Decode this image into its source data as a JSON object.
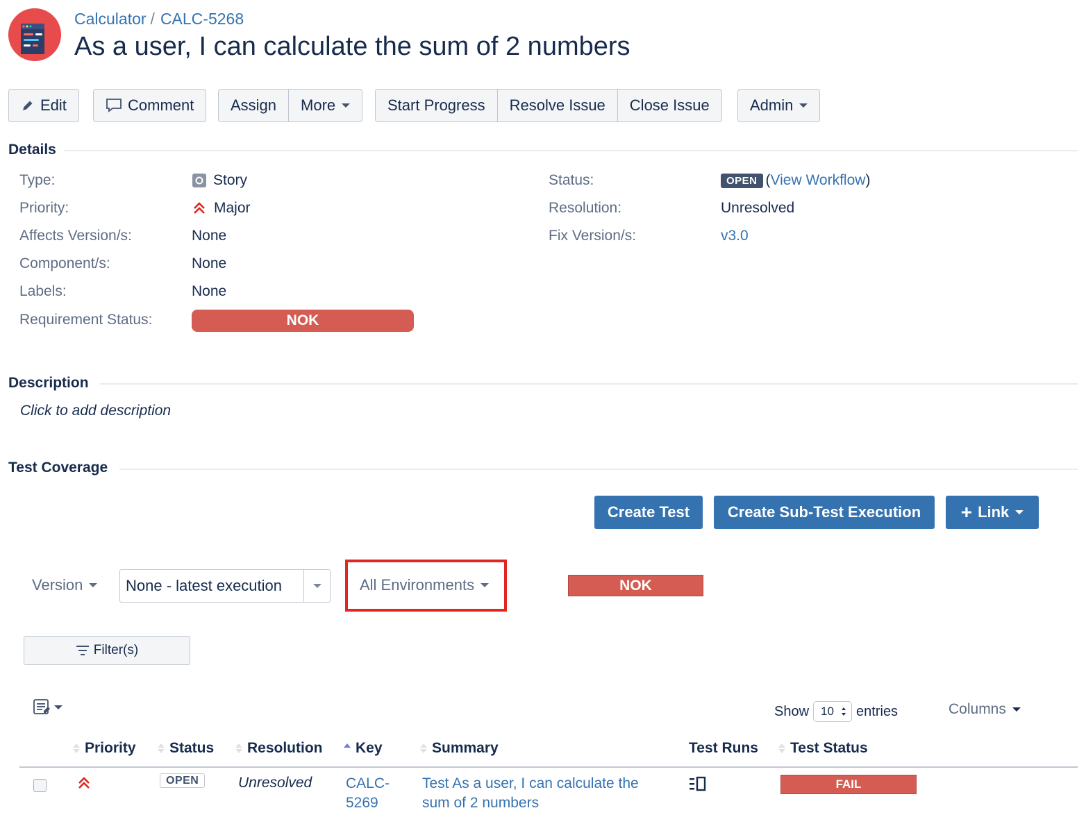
{
  "breadcrumb": {
    "project": "Calculator",
    "separator": "/",
    "issue_key": "CALC-5268"
  },
  "issue": {
    "title": "As a user, I can calculate the sum of 2 numbers"
  },
  "toolbar": {
    "edit": "Edit",
    "comment": "Comment",
    "assign": "Assign",
    "more": "More",
    "start_progress": "Start Progress",
    "resolve_issue": "Resolve Issue",
    "close_issue": "Close Issue",
    "admin": "Admin"
  },
  "details": {
    "heading": "Details",
    "type": {
      "label": "Type:",
      "value": "Story"
    },
    "priority": {
      "label": "Priority:",
      "value": "Major"
    },
    "affects_version": {
      "label": "Affects Version/s:",
      "value": "None"
    },
    "components": {
      "label": "Component/s:",
      "value": "None"
    },
    "labels": {
      "label": "Labels:",
      "value": "None"
    },
    "requirement_status": {
      "label": "Requirement Status:",
      "value": "NOK"
    },
    "status": {
      "label": "Status:",
      "value": "OPEN",
      "open_paren": "(",
      "link": "View Workflow",
      "close_paren": ")"
    },
    "resolution": {
      "label": "Resolution:",
      "value": "Unresolved"
    },
    "fix_version": {
      "label": "Fix Version/s:",
      "value": "v3.0"
    }
  },
  "description": {
    "heading": "Description",
    "placeholder": "Click to add description"
  },
  "test_coverage": {
    "heading": "Test Coverage",
    "create_test": "Create Test",
    "create_sub_test_execution": "Create Sub-Test Execution",
    "link": "Link",
    "link_plus": "+",
    "version_label": "Version",
    "version_value": "None - latest execution",
    "environment": "All Environments",
    "overall_status": "NOK",
    "filters_label": "Filter(s)",
    "show_label": "Show",
    "entries_value": "10",
    "entries_label": "entries",
    "columns_label": "Columns"
  },
  "table": {
    "headers": {
      "priority": "Priority",
      "status": "Status",
      "resolution": "Resolution",
      "key": "Key",
      "summary": "Summary",
      "test_runs": "Test Runs",
      "test_status": "Test Status"
    },
    "rows": [
      {
        "status": "OPEN",
        "resolution": "Unresolved",
        "key_line1": "CALC-",
        "key_line2": "5269",
        "summary_line1": "Test As a user, I can calculate the",
        "summary_line2": "sum of 2 numbers",
        "test_status": "FAIL"
      }
    ]
  },
  "colors": {
    "link": "#3572b0",
    "primary_button": "#3572b0",
    "nok": "#d45c53",
    "open_lozenge": "#42526e",
    "highlight": "#e0261f",
    "priority_major": "#e0261f"
  },
  "icons": {
    "avatar": "project-avatar-icon",
    "edit": "pencil-icon",
    "comment": "speech-bubble-icon",
    "type": "story-icon",
    "priority": "double-chevron-up-icon",
    "filter": "funnel-icon",
    "list": "list-options-icon",
    "test_runs": "test-runs-icon"
  }
}
